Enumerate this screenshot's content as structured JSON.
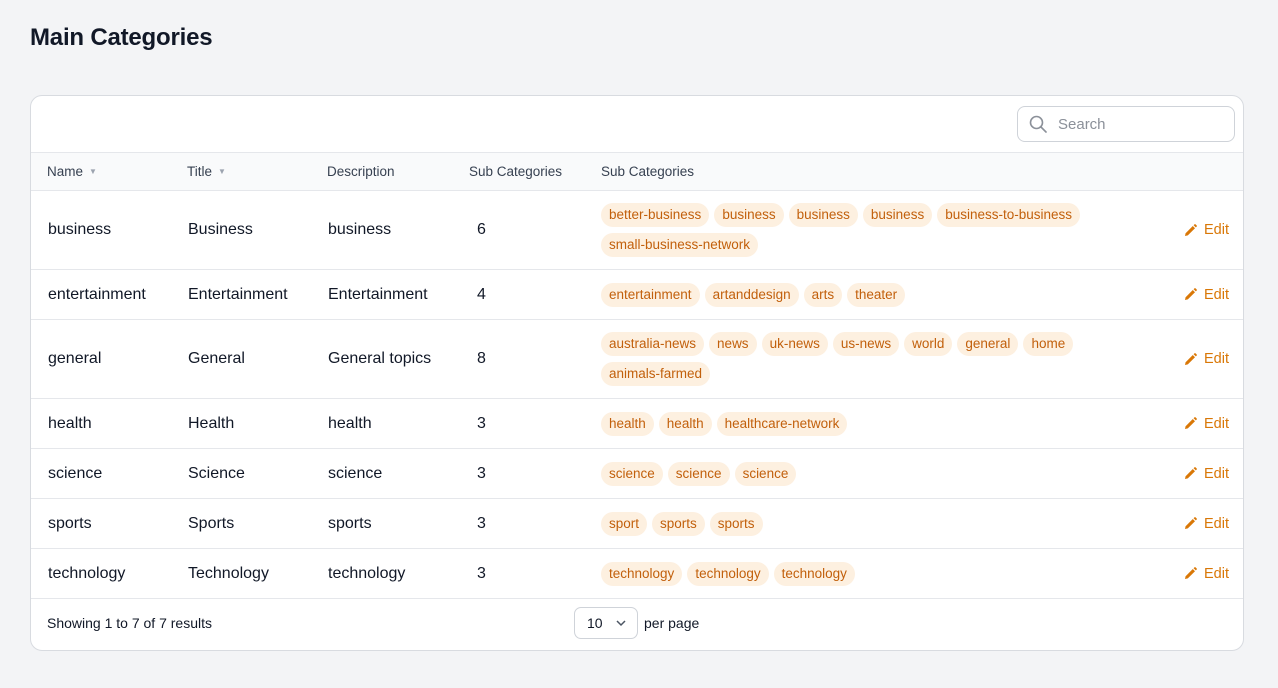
{
  "page": {
    "title": "Main Categories"
  },
  "search": {
    "placeholder": "Search"
  },
  "table": {
    "headers": [
      "Name",
      "Title",
      "Description",
      "Sub Categories",
      "Sub Categories"
    ],
    "edit_label": "Edit",
    "rows": [
      {
        "name": "business",
        "title": "Business",
        "description": "business",
        "count": "6",
        "tags": [
          "better-business",
          "business",
          "business",
          "business",
          "business-to-business",
          "small-business-network"
        ]
      },
      {
        "name": "entertainment",
        "title": "Entertainment",
        "description": "Entertainment",
        "count": "4",
        "tags": [
          "entertainment",
          "artanddesign",
          "arts",
          "theater"
        ]
      },
      {
        "name": "general",
        "title": "General",
        "description": "General topics",
        "count": "8",
        "tags": [
          "australia-news",
          "news",
          "uk-news",
          "us-news",
          "world",
          "general",
          "home",
          "animals-farmed"
        ]
      },
      {
        "name": "health",
        "title": "Health",
        "description": "health",
        "count": "3",
        "tags": [
          "health",
          "health",
          "healthcare-network"
        ]
      },
      {
        "name": "science",
        "title": "Science",
        "description": "science",
        "count": "3",
        "tags": [
          "science",
          "science",
          "science"
        ]
      },
      {
        "name": "sports",
        "title": "Sports",
        "description": "sports",
        "count": "3",
        "tags": [
          "sport",
          "sports",
          "sports"
        ]
      },
      {
        "name": "technology",
        "title": "Technology",
        "description": "technology",
        "count": "3",
        "tags": [
          "technology",
          "technology",
          "technology"
        ]
      }
    ]
  },
  "footer": {
    "results": "Showing 1 to 7 of 7 results",
    "per_page_value": "10",
    "per_page_label": "per page"
  },
  "colors": {
    "accent": "#d97706",
    "tag_bg": "#fdf0e0",
    "tag_text": "#c2600c",
    "background": "#f3f4f6"
  }
}
